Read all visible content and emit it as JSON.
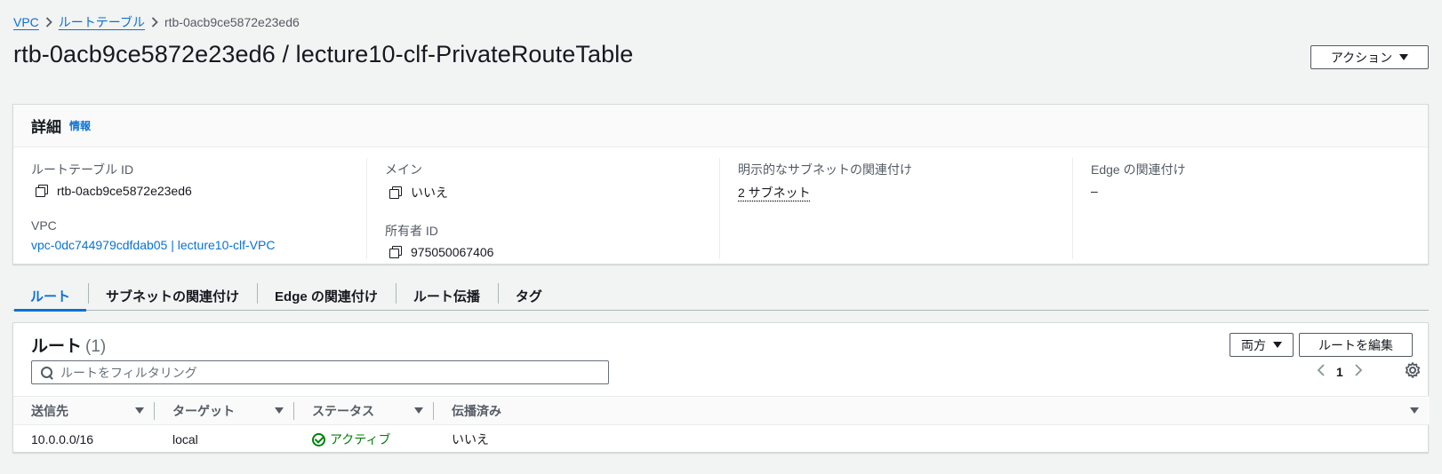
{
  "breadcrumb": {
    "items": [
      "VPC",
      "ルートテーブル"
    ],
    "current": "rtb-0acb9ce5872e23ed6"
  },
  "page_title": "rtb-0acb9ce5872e23ed6 / lecture10-clf-PrivateRouteTable",
  "actions_label": "アクション",
  "details": {
    "title": "詳細",
    "info_link": "情報",
    "route_table_id_label": "ルートテーブル ID",
    "route_table_id": "rtb-0acb9ce5872e23ed6",
    "vpc_label": "VPC",
    "vpc_value": "vpc-0dc744979cdfdab05 | lecture10-clf-VPC",
    "main_label": "メイン",
    "main_value": "いいえ",
    "owner_label": "所有者 ID",
    "owner_value": "975050067406",
    "subnet_assoc_label": "明示的なサブネットの関連付け",
    "subnet_assoc_value": "2 サブネット",
    "edge_assoc_label": "Edge の関連付け",
    "edge_assoc_value": "–"
  },
  "tabs": [
    "ルート",
    "サブネットの関連付け",
    "Edge の関連付け",
    "ルート伝播",
    "タグ"
  ],
  "routes": {
    "title": "ルート",
    "count": "(1)",
    "filter_button": "両方",
    "edit_button": "ルートを編集",
    "search_placeholder": "ルートをフィルタリング",
    "page": "1",
    "columns": [
      "送信先",
      "ターゲット",
      "ステータス",
      "伝播済み"
    ],
    "rows": [
      {
        "destination": "10.0.0.0/16",
        "target": "local",
        "status": "アクティブ",
        "propagated": "いいえ"
      }
    ]
  },
  "colors": {
    "link": "#0972d3",
    "active_status": "#037f0c"
  },
  "icons": [
    "chevron-right-icon",
    "caret-down-icon",
    "copy-icon",
    "search-icon",
    "chevron-left-icon",
    "gear-icon",
    "check-circle-icon"
  ]
}
